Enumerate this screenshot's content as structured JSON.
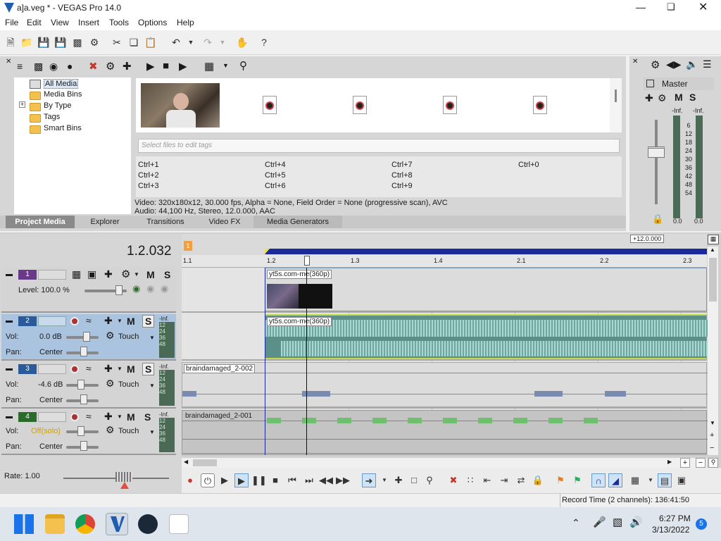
{
  "window": {
    "title": "a]a.veg * - VEGAS Pro 14.0",
    "minimize_icon": "minimize-icon",
    "maximize_icon": "maximize-icon",
    "close_icon": "close-icon"
  },
  "menu": [
    "File",
    "Edit",
    "View",
    "Insert",
    "Tools",
    "Options",
    "Help"
  ],
  "media_tree": [
    {
      "label": "All Media",
      "selected": true
    },
    {
      "label": "Media Bins"
    },
    {
      "label": "By Type",
      "expander": "+"
    },
    {
      "label": "Tags"
    },
    {
      "label": "Smart Bins"
    }
  ],
  "tag_placeholder": "Select files to edit tags",
  "shortcuts": {
    "col1": [
      "Ctrl+1",
      "Ctrl+2",
      "Ctrl+3"
    ],
    "col2": [
      "Ctrl+4",
      "Ctrl+5",
      "Ctrl+6"
    ],
    "col3": [
      "Ctrl+7",
      "Ctrl+8",
      "Ctrl+9"
    ],
    "col4": [
      "Ctrl+0"
    ]
  },
  "media_info": {
    "video": "Video: 320x180x12, 30.000 fps, Alpha = None, Field Order = None (progressive scan), AVC",
    "audio": "Audio: 44,100 Hz, Stereo, 12.0.000, AAC"
  },
  "tabs": [
    "Project Media",
    "Explorer",
    "Transitions",
    "Video FX",
    "Media Generators"
  ],
  "master": {
    "title": "Master",
    "m": "M",
    "s": "S",
    "inf_left": "-Inf.",
    "inf_right": "-Inf.",
    "scale": [
      "6",
      "12",
      "18",
      "24",
      "30",
      "36",
      "42",
      "48",
      "54"
    ],
    "bottom_left": "0.0",
    "bottom_right": "0.0"
  },
  "timecode": "1.2.032",
  "marker_flag": "1",
  "region_length": "+12.0.000",
  "ruler": [
    "1.1",
    "1.2",
    "1.3",
    "1.4",
    "2.1",
    "2.2",
    "2.3"
  ],
  "tracks": [
    {
      "num": "1",
      "type": "video",
      "level_label": "Level: 100.0 %",
      "m": "M",
      "s": "S",
      "clip": "yt5s.com-me(360p)"
    },
    {
      "num": "2",
      "type": "audio",
      "vol_label": "Vol:",
      "vol": "0.0 dB",
      "pan_label": "Pan:",
      "pan": "Center",
      "mode": "Touch",
      "m": "M",
      "s": "S",
      "inf": "-Inf.",
      "meter": [
        "12",
        "24",
        "36",
        "48"
      ],
      "clip": "yt5s.com-me(360p)"
    },
    {
      "num": "3",
      "type": "audio",
      "vol_label": "Vol:",
      "vol": "-4.6 dB",
      "pan_label": "Pan:",
      "pan": "Center",
      "mode": "Touch",
      "m": "M",
      "s": "S",
      "inf": "-Inf.",
      "meter": [
        "12",
        "24",
        "36",
        "48"
      ],
      "clip": "braindamaged_2-002"
    },
    {
      "num": "4",
      "type": "audio",
      "vol_label": "Vol:",
      "vol": "Off(solo)",
      "pan_label": "Pan:",
      "pan": "Center",
      "mode": "Touch",
      "m": "M",
      "s": "S",
      "inf": "-Inf.",
      "meter": [
        "12",
        "24",
        "36",
        "48"
      ],
      "clip": "braindamaged_2-001"
    }
  ],
  "rate": "Rate: 1.00",
  "status": "Record Time (2 channels): 136:41:50",
  "taskbar": {
    "time": "6:27 PM",
    "date": "3/13/2022",
    "badge": "5"
  },
  "colors": {
    "accent": "#1b2a9a",
    "track_selected": "#aac4e0",
    "audio_wave": "#8fc1b8",
    "video_track": "#6a3a8a",
    "audio_track_color": "#2a6a2a"
  }
}
